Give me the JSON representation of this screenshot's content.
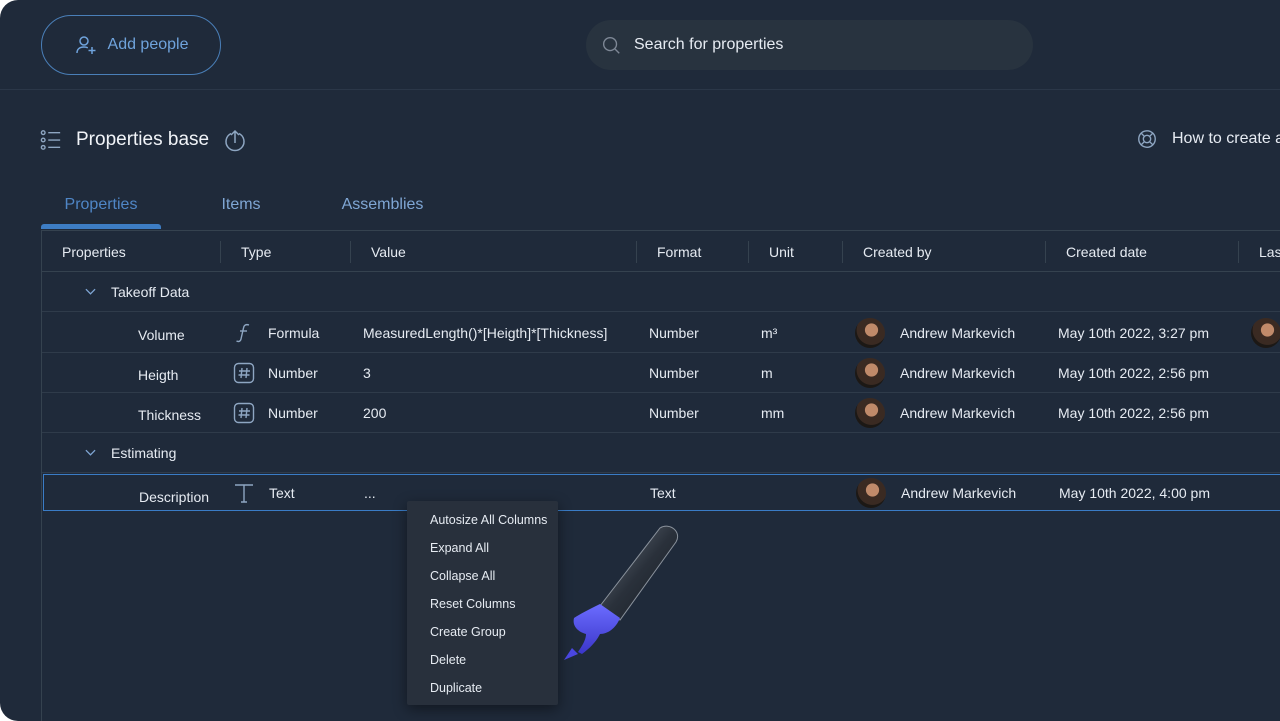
{
  "topbar": {
    "add_people_label": "Add people",
    "search_placeholder": "Search for properties"
  },
  "page": {
    "title": "Properties base",
    "help_link": "How to create a"
  },
  "tabs": [
    {
      "label": "Properties",
      "active": true
    },
    {
      "label": "Items",
      "active": false
    },
    {
      "label": "Assemblies",
      "active": false
    }
  ],
  "table": {
    "columns": [
      "Properties",
      "Type",
      "Value",
      "Format",
      "Unit",
      "Created by",
      "Created date",
      "Las"
    ],
    "groups": [
      {
        "name": "Takeoff Data",
        "rows": [
          {
            "property": "Volume",
            "type_icon": "formula-icon",
            "type": "Formula",
            "value": "MeasuredLength()*[Heigth]*[Thickness]",
            "format": "Number",
            "unit": "m³",
            "created_by": "Andrew Markevich",
            "created_date": "May 10th 2022, 3:27 pm"
          },
          {
            "property": "Heigth",
            "type_icon": "hash-icon",
            "type": "Number",
            "value": "3",
            "format": "Number",
            "unit": "m",
            "created_by": "Andrew Markevich",
            "created_date": "May 10th 2022, 2:56 pm"
          },
          {
            "property": "Thickness",
            "type_icon": "hash-icon",
            "type": "Number",
            "value": "200",
            "format": "Number",
            "unit": "mm",
            "created_by": "Andrew Markevich",
            "created_date": "May 10th 2022, 2:56 pm"
          }
        ]
      },
      {
        "name": "Estimating",
        "rows": [
          {
            "property": "Description",
            "type_icon": "text-type-icon",
            "type": "Text",
            "value": "...",
            "format": "Text",
            "unit": "",
            "created_by": "Andrew Markevich",
            "created_date": "May 10th 2022, 4:00 pm"
          }
        ]
      }
    ]
  },
  "context_menu": {
    "items": [
      "Autosize All Columns",
      "Expand All",
      "Collapse All",
      "Reset Columns",
      "Create Group",
      "Delete",
      "Duplicate"
    ]
  },
  "colors": {
    "background": "#1f2a3a",
    "accent": "#3d7dc4",
    "link": "#6fa3dc",
    "menu_bg": "#28303c"
  }
}
